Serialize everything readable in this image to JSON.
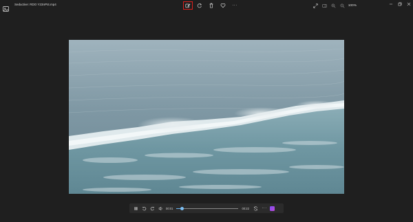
{
  "window": {
    "title": "Seductive: RDO Y23nPt4.mp4",
    "zoom": "100%"
  },
  "toolbar": {
    "edit_icon": "edit-video-icon",
    "rotate_icon": "rotate-icon",
    "delete_icon": "trash-icon",
    "favorite_icon": "heart-icon",
    "more_icon": "more-icon",
    "more_label": "···"
  },
  "playback": {
    "current_time": "00:01",
    "total_time": "00:22",
    "progress": 0.09,
    "more_label": "···"
  },
  "colors": {
    "highlight": "#e0201e",
    "seek_accent": "#6ab4f0",
    "background": "#1f1f1f"
  }
}
